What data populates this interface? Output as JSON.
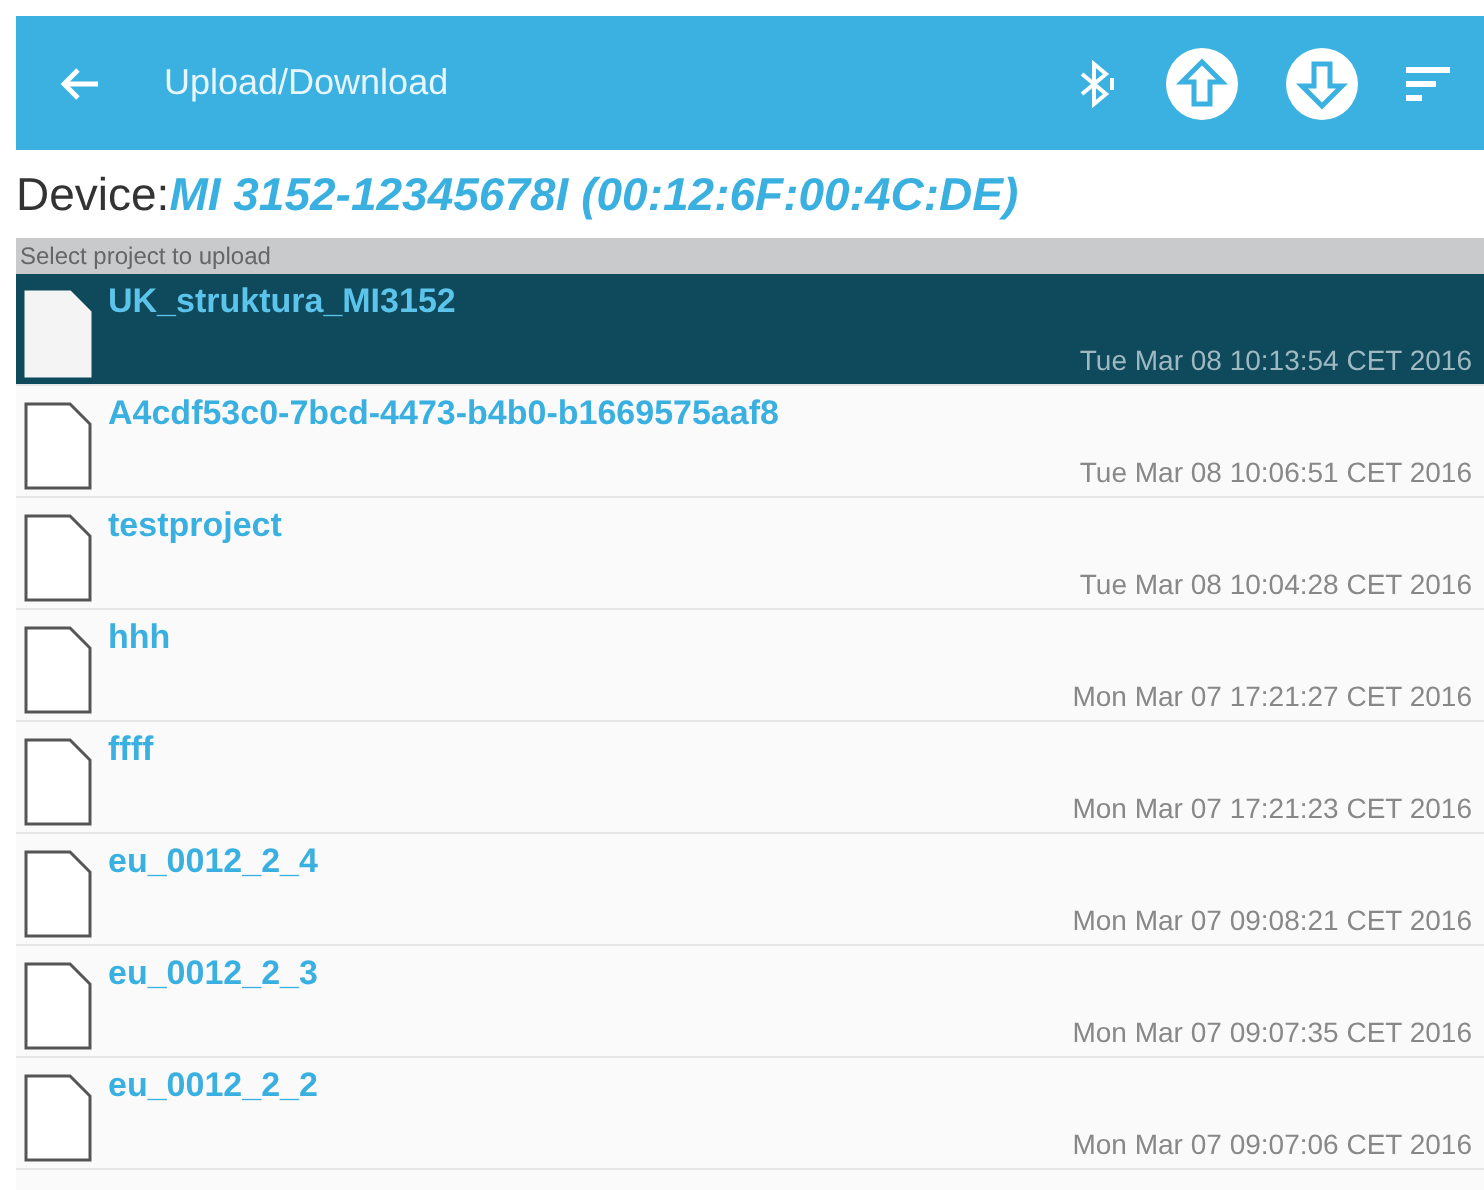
{
  "app_bar": {
    "title": "Upload/Download"
  },
  "device": {
    "label": "Device:",
    "name": "MI 3152-12345678I (00:12:6F:00:4C:DE)"
  },
  "subheader": "Select project to upload",
  "projects": [
    {
      "name": "UK_struktura_MI3152",
      "date": "Tue Mar 08 10:13:54 CET 2016",
      "selected": true
    },
    {
      "name": "A4cdf53c0-7bcd-4473-b4b0-b1669575aaf8",
      "date": "Tue Mar 08 10:06:51 CET 2016",
      "selected": false
    },
    {
      "name": "testproject",
      "date": "Tue Mar 08 10:04:28 CET 2016",
      "selected": false
    },
    {
      "name": "hhh",
      "date": "Mon Mar 07 17:21:27 CET 2016",
      "selected": false
    },
    {
      "name": "ffff",
      "date": "Mon Mar 07 17:21:23 CET 2016",
      "selected": false
    },
    {
      "name": "eu_0012_2_4",
      "date": "Mon Mar 07 09:08:21 CET 2016",
      "selected": false
    },
    {
      "name": "eu_0012_2_3",
      "date": "Mon Mar 07 09:07:35 CET 2016",
      "selected": false
    },
    {
      "name": "eu_0012_2_2",
      "date": "Mon Mar 07 09:07:06 CET 2016",
      "selected": false
    }
  ]
}
